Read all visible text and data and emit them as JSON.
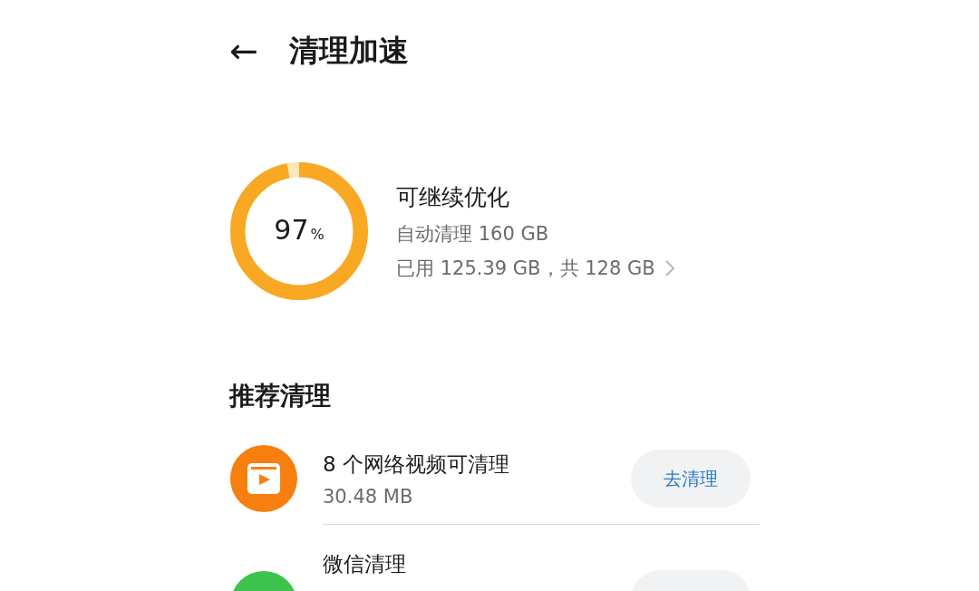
{
  "header": {
    "back_icon": "←",
    "title": "清理加速"
  },
  "storage": {
    "level": 0.97,
    "percent": "97",
    "percent_unit": "%",
    "status": "可继续优化",
    "auto_clean": "自动清理 160 GB",
    "usage": "已用 125.39 GB，共 128 GB"
  },
  "section_title": "推荐清理",
  "items": [
    {
      "kind": "video",
      "color": "#f77f0f",
      "title": "8 个网络视频可清理",
      "size": "30.48 MB",
      "button": "去清理"
    },
    {
      "kind": "wechat",
      "color": "#3dc44f",
      "title": "微信清理"
    }
  ]
}
